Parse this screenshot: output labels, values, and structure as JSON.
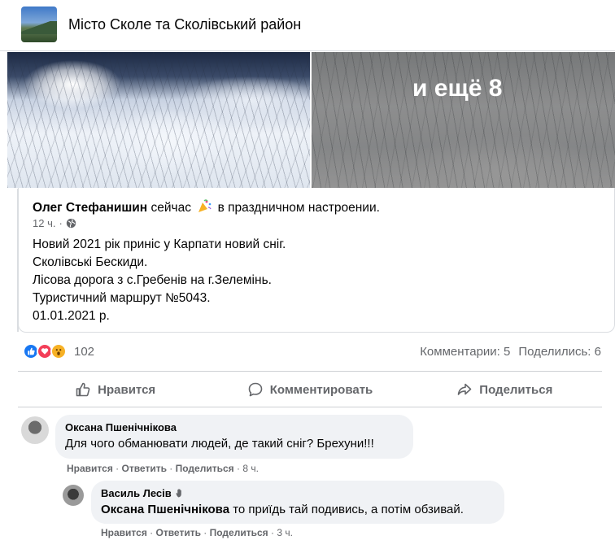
{
  "group": {
    "title": "Місто Сколе та Сколівський район"
  },
  "photos": {
    "more_label": "и ещё 8"
  },
  "post": {
    "author": "Олег Стефанишин",
    "feeling_prefix": "сейчас",
    "feeling_text": "в праздничном настроении.",
    "time": "12 ч.",
    "lines": [
      "Новий 2021 рік приніс у Карпати новий сніг.",
      "Сколівські Бескиди.",
      "Лісова дорога з с.Гребенів на г.Зелемінь.",
      "Туристичний маршрут №5043.",
      "01.01.2021 р."
    ]
  },
  "reactions": {
    "count": "102",
    "comments": "Комментарии: 5",
    "shares": "Поделились: 6",
    "icons": [
      "like-icon",
      "love-icon",
      "wow-icon"
    ]
  },
  "actions": {
    "like": "Нравится",
    "comment": "Комментировать",
    "share": "Поделиться"
  },
  "comments": [
    {
      "author": "Оксана Пшенічнікова",
      "text": "Для чого обманювати людей, де такий сніг? Брехуни!!!",
      "like": "Нравится",
      "reply": "Ответить",
      "share": "Поделиться",
      "time": "8 ч."
    },
    {
      "author": "Василь Лесів",
      "mention": "Оксана Пшенічнікова",
      "text": " то приїдь тай подивись, а потім обзивай.",
      "like": "Нравится",
      "reply": "Ответить",
      "share": "Поделиться",
      "time": "3 ч."
    }
  ],
  "colors": {
    "accent": "#1877f2",
    "muted": "#65676b",
    "bubble": "#f0f2f5"
  }
}
